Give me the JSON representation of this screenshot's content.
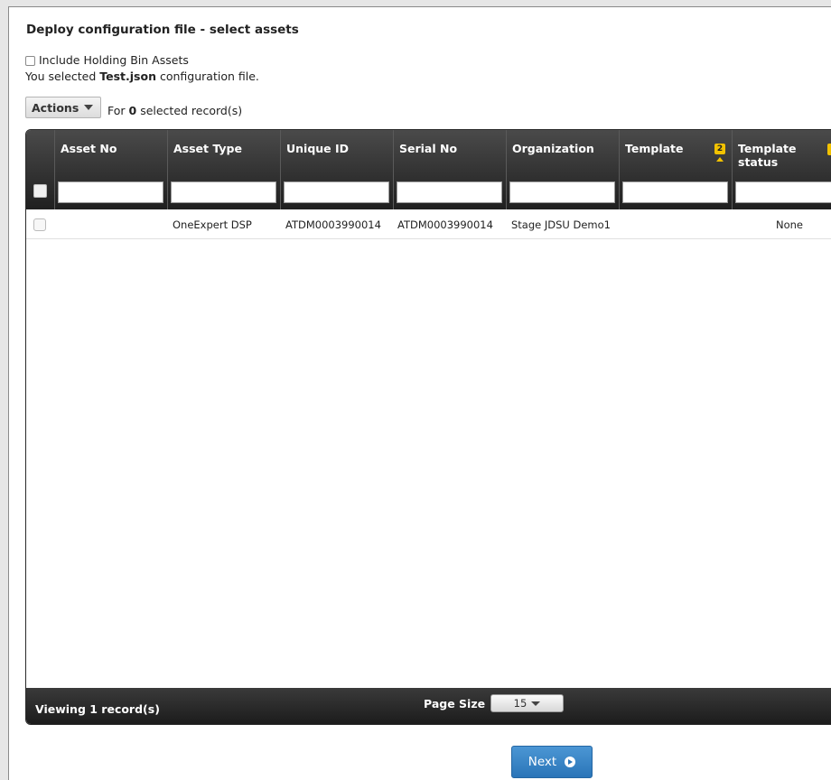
{
  "page": {
    "title": "Deploy configuration file - select assets"
  },
  "options": {
    "holding_bin_label": "Include Holding Bin Assets",
    "holding_bin_checked": false,
    "selected_prefix": "You selected ",
    "selected_file": "Test.json",
    "selected_suffix": " configuration file."
  },
  "toolbar": {
    "actions_label": "Actions",
    "for_prefix": "For ",
    "selected_count": "0",
    "for_suffix": " selected record(s)"
  },
  "grid": {
    "columns": {
      "asset_no": "Asset No",
      "asset_type": "Asset Type",
      "unique_id": "Unique ID",
      "serial_no": "Serial No",
      "organization": "Organization",
      "template": "Template",
      "template_status_line1": "Template",
      "template_status_line2": "status"
    },
    "sort_badge": "2",
    "rows": [
      {
        "asset_no": "",
        "asset_type": "OneExpert DSP",
        "unique_id": "ATDM0003990014",
        "serial_no": "ATDM0003990014",
        "organization": "Stage JDSU Demo1",
        "template": "",
        "template_status": "None"
      }
    ],
    "footer": {
      "viewing": "Viewing 1 record(s)",
      "page_size_label": "Page Size",
      "page_size_value": "15"
    }
  },
  "buttons": {
    "next_label": "Next"
  },
  "colors": {
    "header_dark": "#2a2a2a",
    "badge_yellow": "#f2c200",
    "next_blue": "#3a85c6"
  }
}
